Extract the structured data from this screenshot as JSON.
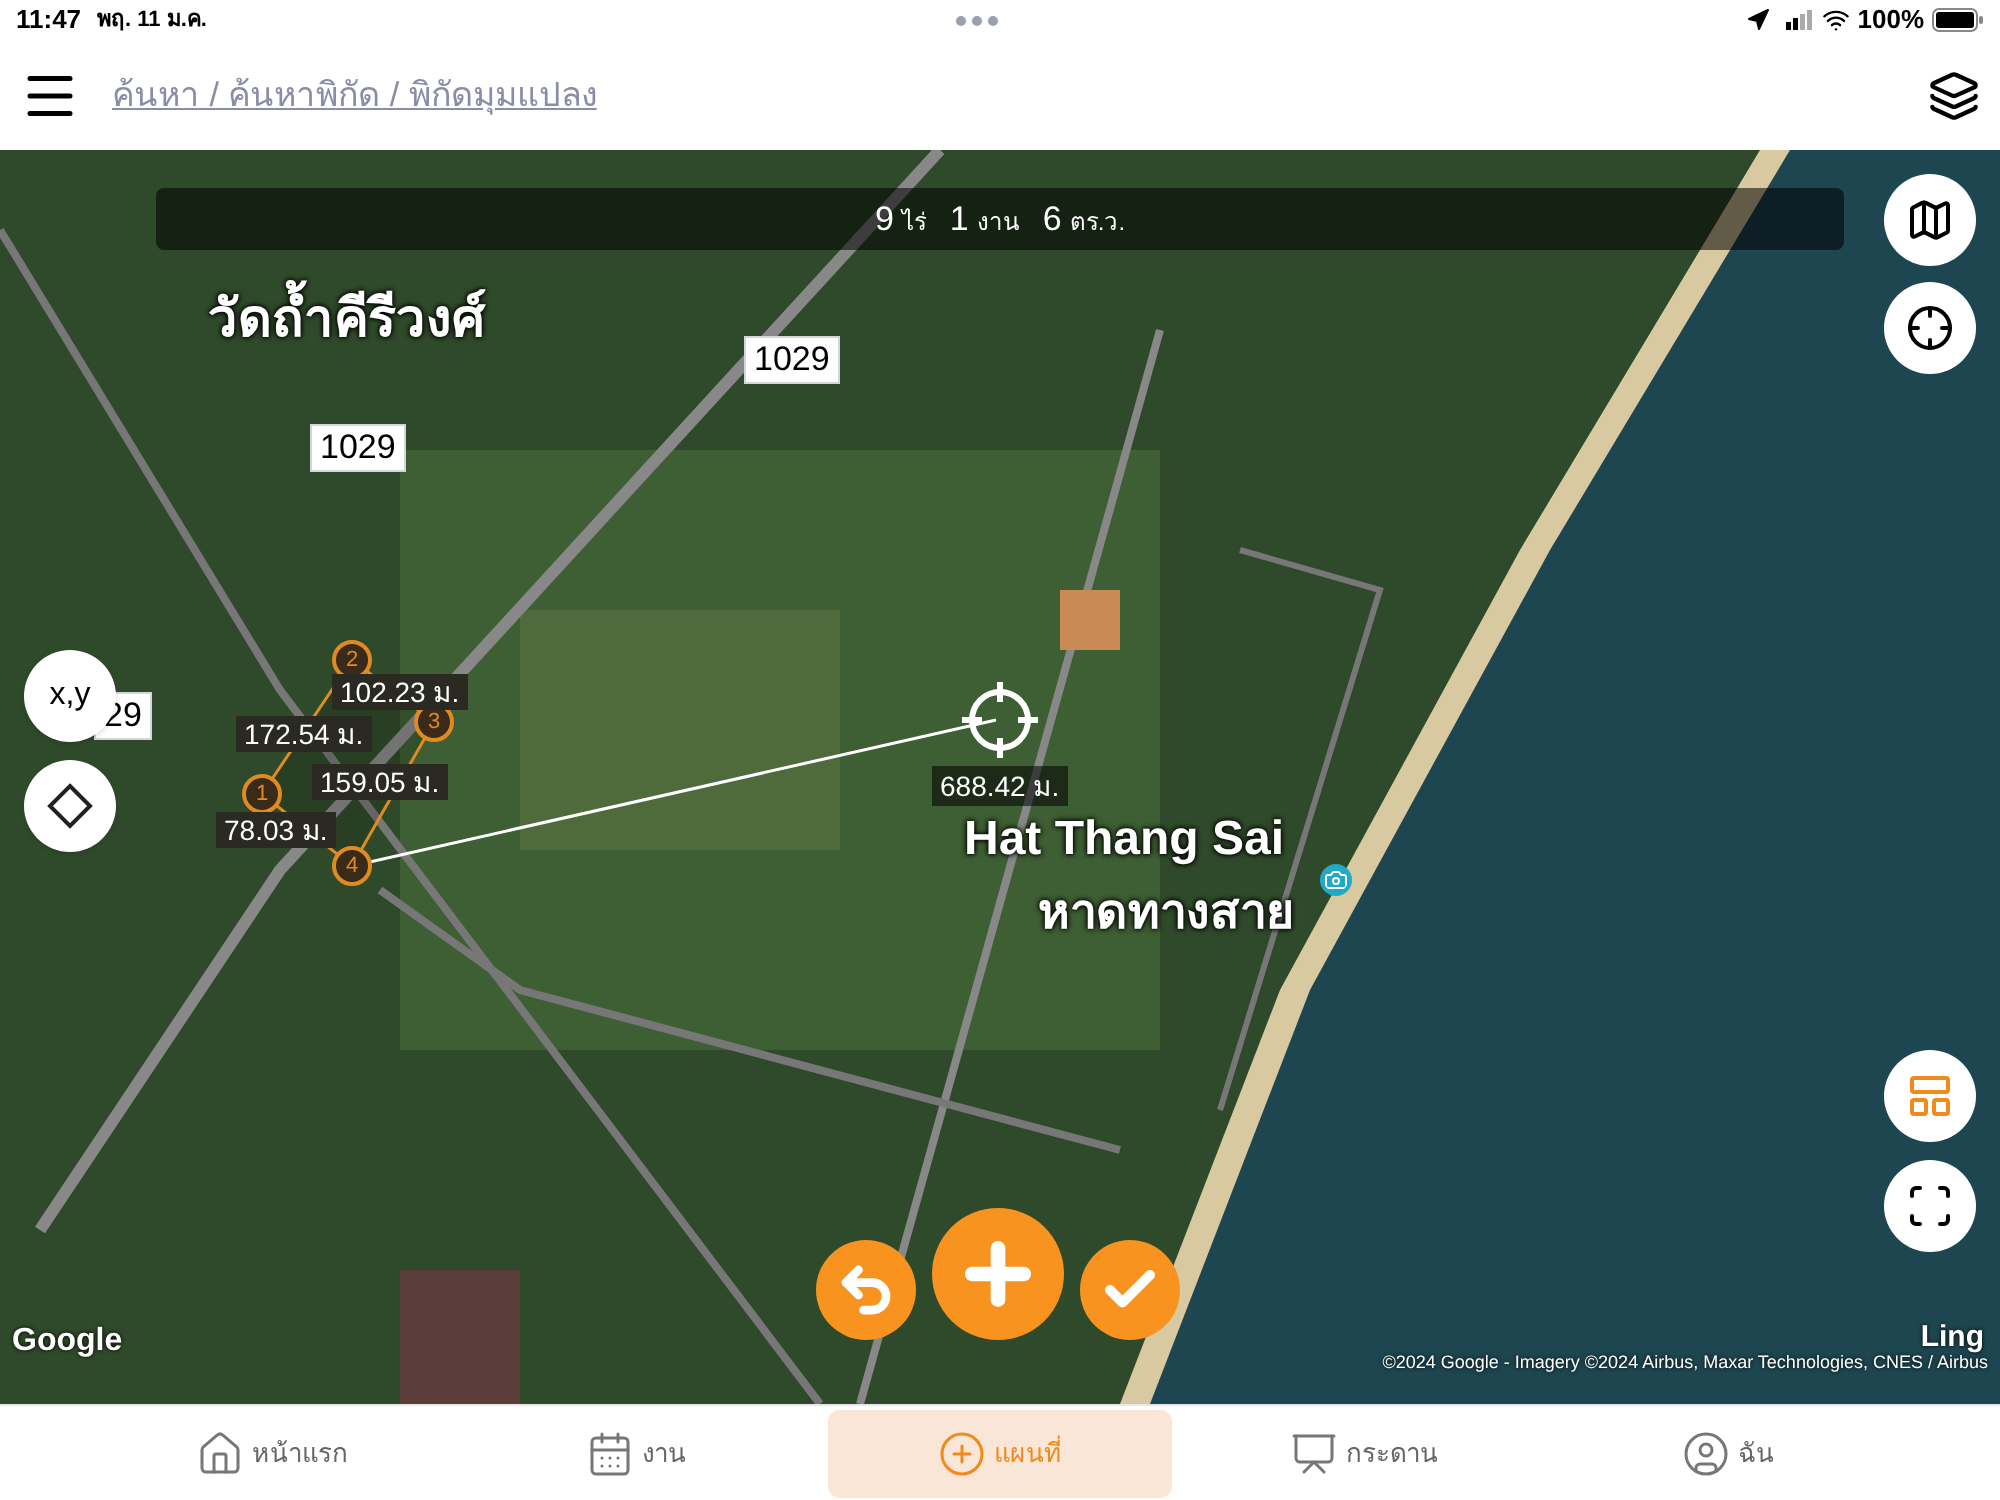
{
  "status_bar": {
    "time": "11:47",
    "date": "พฤ. 11 ม.ค.",
    "battery": "100%"
  },
  "header": {
    "breadcrumb": "ค้นหา / ค้นหาพิกัด / พิกัดมุมแปลง"
  },
  "area_bar": [
    {
      "value": "9",
      "unit": "ไร่"
    },
    {
      "value": "1",
      "unit": "งาน"
    },
    {
      "value": "6",
      "unit": "ตร.ว."
    }
  ],
  "map": {
    "places": [
      {
        "kind": "temple",
        "name": "วัดถ้ำคีรีวงศ์"
      },
      {
        "kind": "road",
        "name": "1029"
      },
      {
        "kind": "road",
        "name": "1029"
      },
      {
        "kind": "road",
        "name": "29"
      },
      {
        "kind": "beach",
        "name": "Hat Thang Sai"
      },
      {
        "kind": "beach",
        "name": "หาดทางสาย"
      }
    ],
    "points": [
      {
        "label": "1"
      },
      {
        "label": "2"
      },
      {
        "label": "3"
      },
      {
        "label": "4"
      }
    ],
    "edges": [
      {
        "length": "102.23 ม."
      },
      {
        "length": "172.54 ม."
      },
      {
        "length": "159.05 ม."
      },
      {
        "length": "78.03 ม."
      }
    ],
    "distance": "688.42 ม.",
    "left_buttons": [
      {
        "kind": "text",
        "label": "x,y"
      },
      {
        "kind": "diamond"
      }
    ],
    "attribution": {
      "logo": "Google",
      "credits": "©2024 Google - Imagery ©2024 Airbus, Maxar Technologies, CNES / Airbus",
      "scale": "Ling"
    }
  },
  "nav": [
    {
      "kind": "home",
      "label": "หน้าแรก",
      "selected": false
    },
    {
      "kind": "calendar",
      "label": "งาน",
      "selected": false
    },
    {
      "kind": "plus",
      "label": "แผนที่",
      "selected": true
    },
    {
      "kind": "board",
      "label": "กระดาน",
      "selected": false
    },
    {
      "kind": "user",
      "label": "ฉัน",
      "selected": false
    }
  ]
}
